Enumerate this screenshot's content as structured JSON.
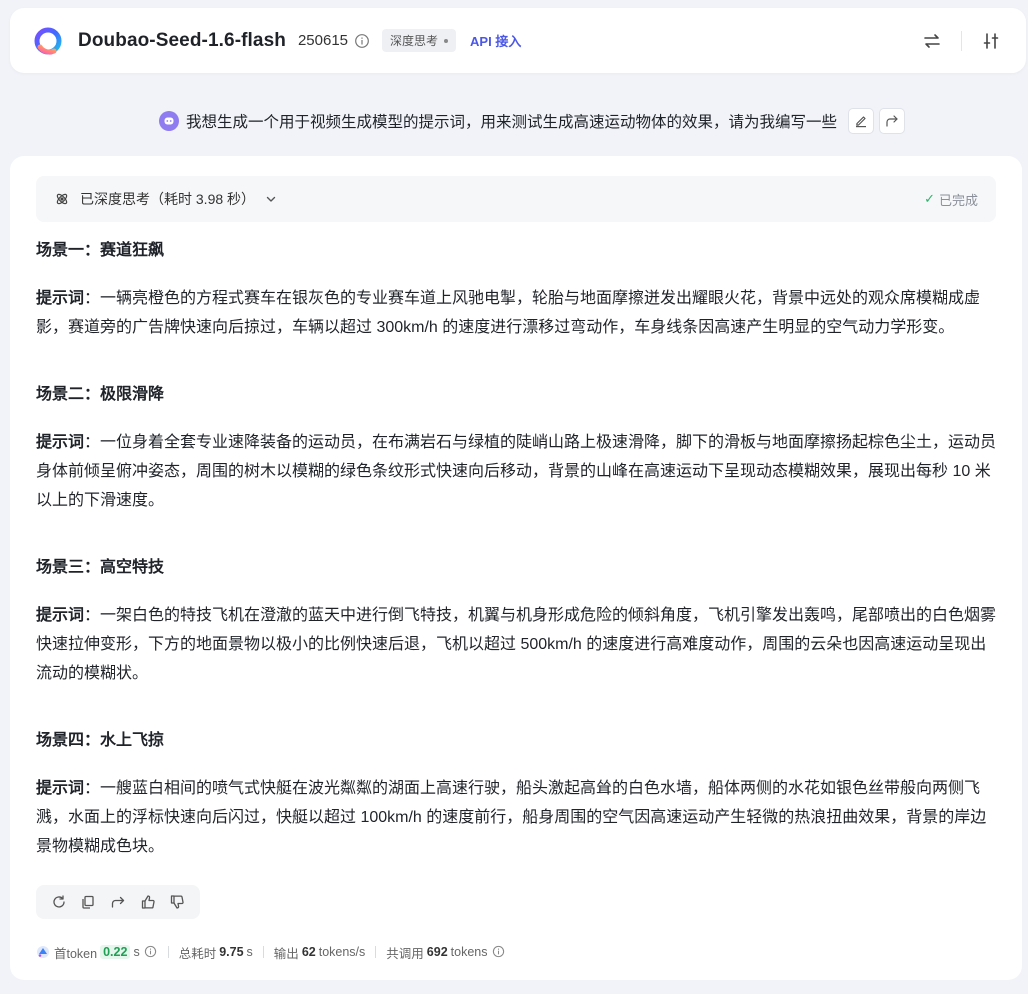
{
  "header": {
    "model_name": "Doubao-Seed-1.6-flash",
    "model_version": "250615",
    "think_tag": "深度思考",
    "api_link": "API 接入"
  },
  "prompt": {
    "text": "我想生成一个用于视频生成模型的提示词，用来测试生成高速运动物体的效果，请为我编写一些"
  },
  "thinking": {
    "label": "已深度思考（耗时 3.98 秒）",
    "status": "已完成"
  },
  "scenes": [
    {
      "title": "场景一：赛道狂飙",
      "prefix": "提示词",
      "text": "：一辆亮橙色的方程式赛车在银灰色的专业赛车道上风驰电掣，轮胎与地面摩擦迸发出耀眼火花，背景中远处的观众席模糊成虚影，赛道旁的广告牌快速向后掠过，车辆以超过 300km/h 的速度进行漂移过弯动作，车身线条因高速产生明显的空气动力学形变。"
    },
    {
      "title": "场景二：极限滑降",
      "prefix": "提示词",
      "text": "：一位身着全套专业速降装备的运动员，在布满岩石与绿植的陡峭山路上极速滑降，脚下的滑板与地面摩擦扬起棕色尘土，运动员身体前倾呈俯冲姿态，周围的树木以模糊的绿色条纹形式快速向后移动，背景的山峰在高速运动下呈现动态模糊效果，展现出每秒 10 米以上的下滑速度。"
    },
    {
      "title": "场景三：高空特技",
      "prefix": "提示词",
      "text": "：一架白色的特技飞机在澄澈的蓝天中进行倒飞特技，机翼与机身形成危险的倾斜角度，飞机引擎发出轰鸣，尾部喷出的白色烟雾快速拉伸变形，下方的地面景物以极小的比例快速后退，飞机以超过 500km/h 的速度进行高难度动作，周围的云朵也因高速运动呈现出流动的模糊状。"
    },
    {
      "title": "场景四：水上飞掠",
      "prefix": "提示词",
      "text": "：一艘蓝白相间的喷气式快艇在波光粼粼的湖面上高速行驶，船头激起高耸的白色水墙，船体两侧的水花如银色丝带般向两侧飞溅，水面上的浮标快速向后闪过，快艇以超过 100km/h 的速度前行，船身周围的空气因高速运动产生轻微的热浪扭曲效果，背景的岸边景物模糊成色块。"
    }
  ],
  "stats": {
    "first_token_label": "首token",
    "first_token_value": "0.22",
    "first_token_unit": "s",
    "total_label": "总耗时",
    "total_value": "9.75",
    "total_unit": "s",
    "output_label": "输出",
    "output_value": "62",
    "output_unit": "tokens/s",
    "calls_label": "共调用",
    "calls_value": "692",
    "calls_unit": "tokens"
  },
  "colors": {
    "accent": "#4b57e6",
    "done_check": "#2fb36b",
    "first_token_highlight": "#20a055"
  }
}
